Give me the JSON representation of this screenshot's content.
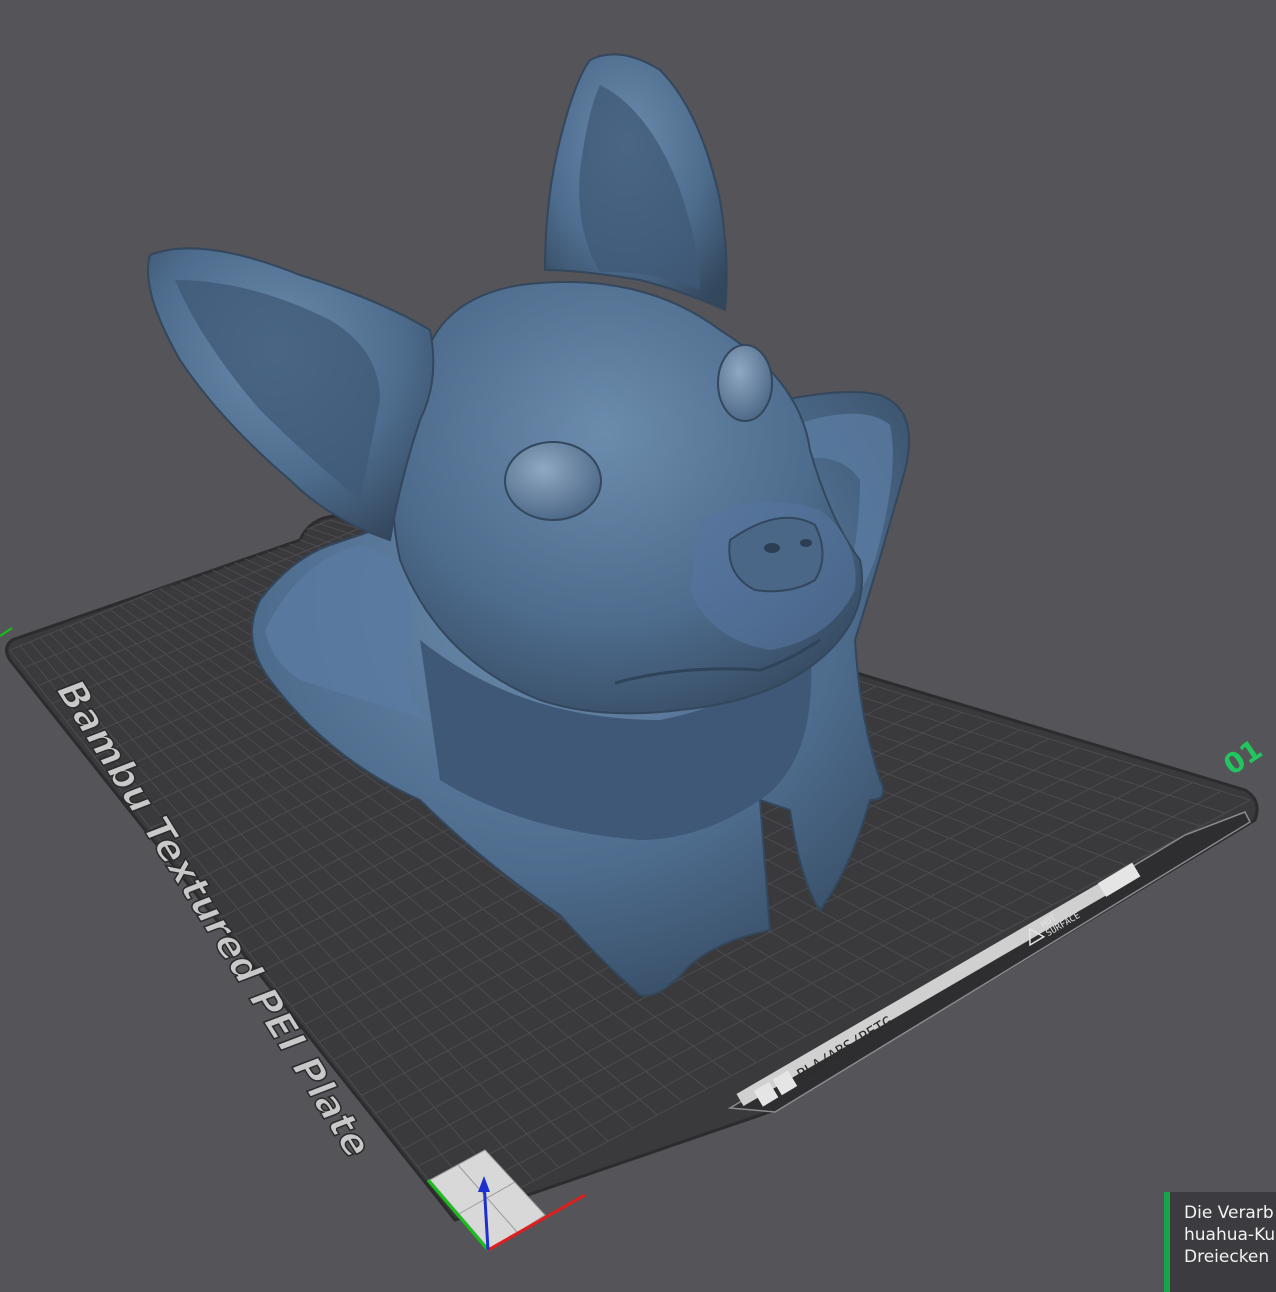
{
  "plate": {
    "name": "Bambu Textured PEI Plate",
    "plate_number": "01",
    "material_label": "PLA/ABS/PETG",
    "hot_surface_line1": "HOT",
    "hot_surface_line2": "SURFACE"
  },
  "model": {
    "name": "chihuahua-bust",
    "color": "#4d6b8c"
  },
  "notification": {
    "line1": "Die Verarb",
    "line2": "huahua-Ku",
    "line3": "Dreiecken"
  },
  "colors": {
    "background": "#545459",
    "plate": "#3a3a3d",
    "grid": "#4b4b50",
    "plate_text": "#c8c8c8",
    "plate_number": "#22c55e",
    "axis_x": "#e11d1d",
    "axis_y": "#16c016",
    "axis_z": "#1e2fd0",
    "notification_accent": "#16a34a"
  },
  "icons": [
    "axis-gizmo-icon",
    "qr-code-icon",
    "hot-surface-icon",
    "nozzle-icon"
  ]
}
